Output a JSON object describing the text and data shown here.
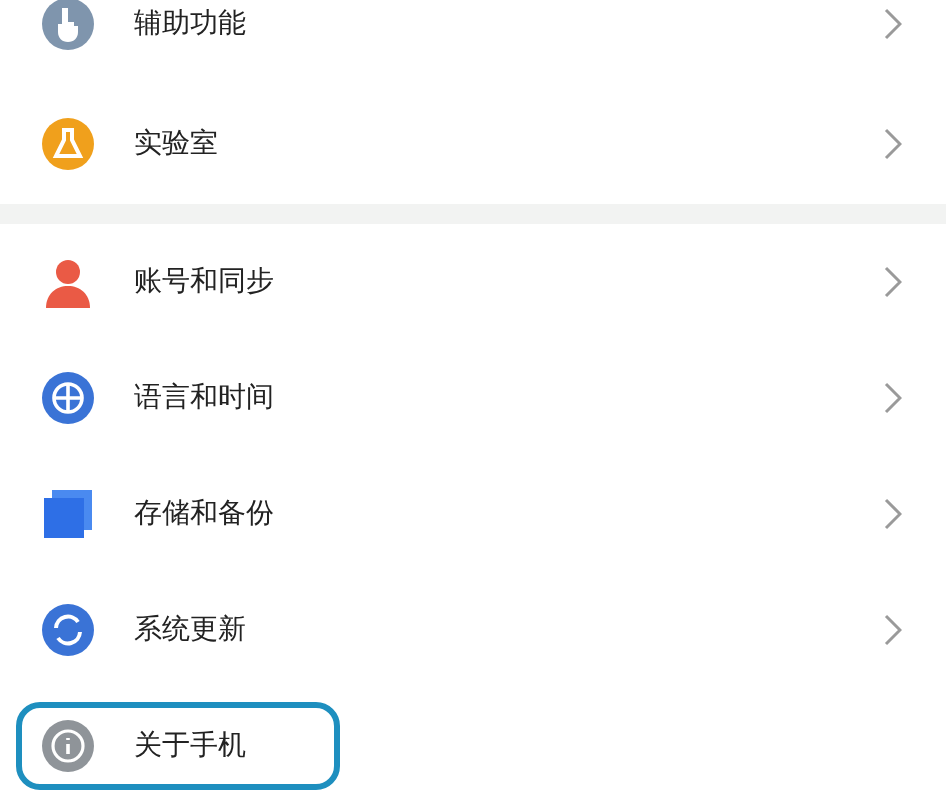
{
  "sections": [
    {
      "items": [
        {
          "kind": "accessibility",
          "label": "辅助功能",
          "chevron": true,
          "highlighted": false
        },
        {
          "kind": "lab",
          "label": "实验室",
          "chevron": true,
          "highlighted": false
        }
      ]
    },
    {
      "items": [
        {
          "kind": "account",
          "label": "账号和同步",
          "chevron": true,
          "highlighted": false
        },
        {
          "kind": "language",
          "label": "语言和时间",
          "chevron": true,
          "highlighted": false
        },
        {
          "kind": "storage",
          "label": "存储和备份",
          "chevron": true,
          "highlighted": false
        },
        {
          "kind": "update",
          "label": "系统更新",
          "chevron": true,
          "highlighted": false
        },
        {
          "kind": "about",
          "label": "关于手机",
          "chevron": false,
          "highlighted": true
        }
      ]
    }
  ]
}
